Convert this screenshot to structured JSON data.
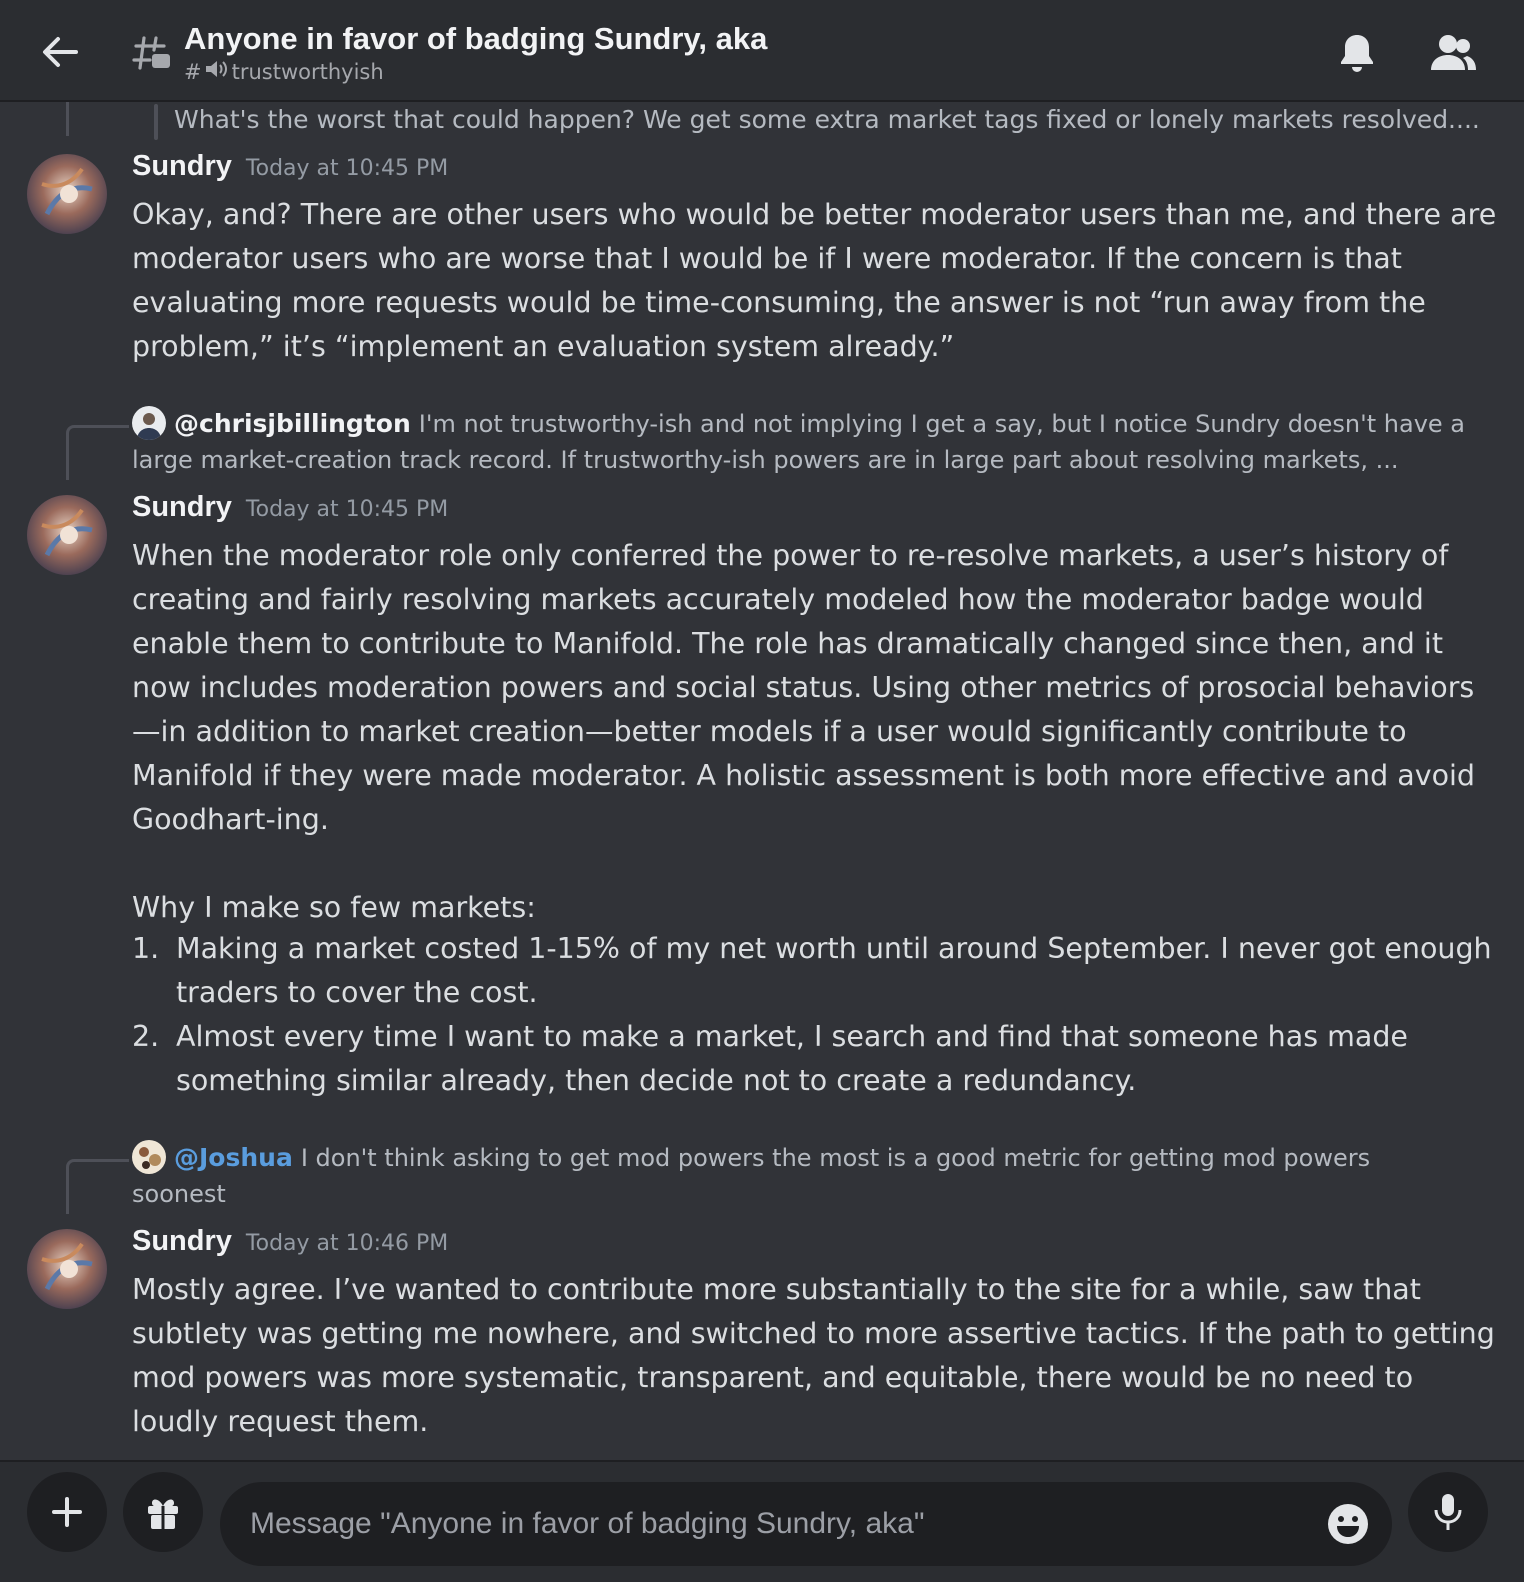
{
  "header": {
    "title": "Anyone in favor of badging Sundry, aka",
    "channel_hash": "#",
    "channel": "trustworthyish"
  },
  "messages": {
    "prev_quote": "What's the worst that could happen? We get some extra market tags fixed or lonely markets resolved....",
    "m1": {
      "author": "Sundry",
      "time": "Today at 10:45 PM",
      "lines": [
        "Okay, and? There are other users who would be better moderator users than me, and there are",
        "moderator users who are worse that I would be if I were moderator. If the concern is that",
        "evaluating more requests would be time-consuming, the answer is not “run away from the",
        "problem,” it’s “implement an evaluation system already.”"
      ]
    },
    "r2": {
      "mention": "@chrisjbillington",
      "line1": "I'm not trustworthy-ish and not implying I get a say, but I notice Sundry doesn't have a",
      "line2": "large market-creation track record. If trustworthy-ish powers are in large part about resolving markets, ..."
    },
    "m2": {
      "author": "Sundry",
      "time": "Today at 10:45 PM",
      "lines": [
        "When the moderator role only conferred the power to re-resolve markets, a user’s history of",
        "creating and fairly resolving markets accurately modeled how the moderator badge would",
        "enable them to contribute to Manifold. The role has dramatically changed since then, and it",
        "now includes moderation powers and social status. Using other metrics of prosocial behaviors",
        "—in addition to market creation—better models if a user would significantly contribute to",
        "Manifold if they were made moderator. A holistic assessment is both more effective and avoid",
        "Goodhart-ing."
      ],
      "list_intro": "Why I make so few markets:",
      "list": [
        {
          "num": "1.",
          "line1": "Making a market costed 1-15% of my net worth until around September. I never got enough",
          "line2": "traders to cover the cost."
        },
        {
          "num": "2.",
          "line1": "Almost every time I want to make a market, I search and find that someone has made",
          "line2": "something similar already, then decide not to create a redundancy."
        }
      ]
    },
    "r3": {
      "mention": "@Joshua",
      "line1": "I don't think asking to get mod powers the most is a good metric for getting mod powers",
      "line2": "soonest"
    },
    "m3": {
      "author": "Sundry",
      "time": "Today at 10:46 PM",
      "lines": [
        "Mostly agree. I’ve wanted to contribute more substantially to the site for a while, saw that",
        "subtlety was getting me nowhere, and switched to more assertive tactics. If the path to getting",
        "mod powers was more systematic, transparent, and equitable, there would be no need to",
        "loudly request them."
      ]
    }
  },
  "composer": {
    "placeholder": "Message \"Anyone in favor of badging Sundry, aka\""
  },
  "icons": {
    "back": "arrow-left-icon",
    "thread": "thread-icon",
    "speaker": "speaker-icon",
    "bell": "bell-icon",
    "members": "members-icon",
    "plus": "plus-icon",
    "gift": "gift-icon",
    "emoji": "emoji-icon",
    "mic": "microphone-icon"
  },
  "colors": {
    "background": "#313338",
    "header": "#2b2d31",
    "input": "#1e1f22",
    "mention_blue": "#5a9dde"
  }
}
